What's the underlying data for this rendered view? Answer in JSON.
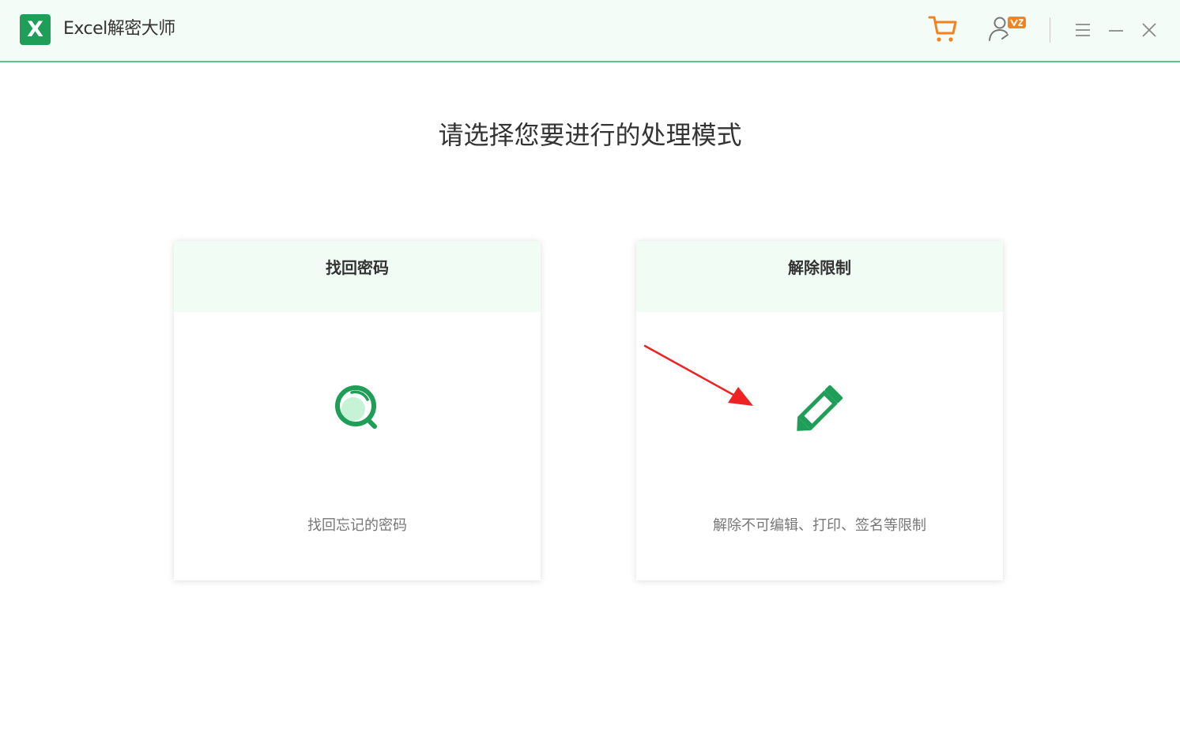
{
  "app": {
    "logo_letter": "X",
    "title": "Excel解密大师"
  },
  "toolbar": {
    "cart_icon": "shopping-cart-icon",
    "account_icon": "user-vip-icon",
    "menu_icon": "hamburger-menu-icon",
    "minimize_icon": "minimize-icon",
    "close_icon": "close-icon"
  },
  "main": {
    "heading": "请选择您要进行的处理模式",
    "cards": [
      {
        "title": "找回密码",
        "icon": "magnifier-search-icon",
        "description": "找回忘记的密码"
      },
      {
        "title": "解除限制",
        "icon": "pencil-edit-icon",
        "description": "解除不可编辑、打印、签名等限制"
      }
    ]
  },
  "colors": {
    "brand_green": "#1e9e57",
    "header_bg": "#f3fcf6",
    "card_header_bg": "#f1fcf5",
    "accent_orange": "#f58220",
    "annotation_red": "#ee2222"
  }
}
